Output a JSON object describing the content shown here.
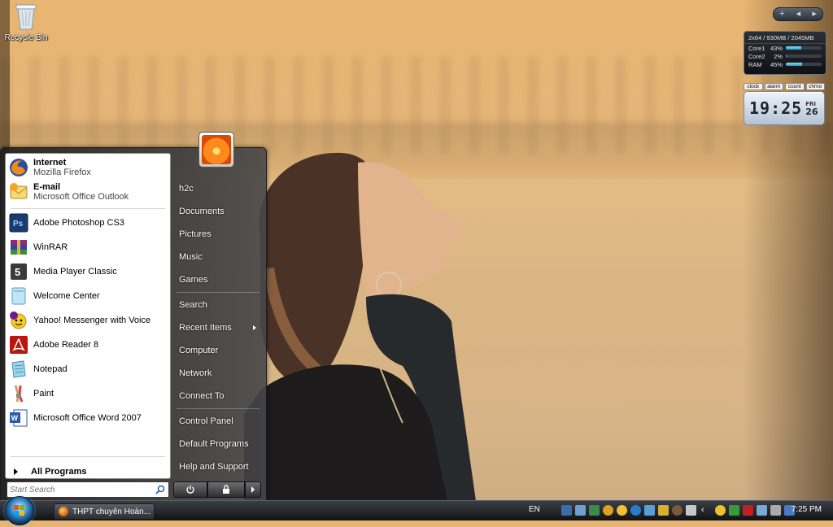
{
  "desktop": {
    "recycle_bin_label": "Recycle Bin"
  },
  "gadgets": {
    "cpu": {
      "header": "2x64 / 930MB / 2045MB",
      "rows": [
        {
          "name": "Core1",
          "percent": "43%",
          "level": 0.43
        },
        {
          "name": "Core2",
          "percent": "2%",
          "level": 0.02
        },
        {
          "name": "RAM",
          "percent": "45%",
          "level": 0.45
        }
      ]
    },
    "clock": {
      "tabs": [
        "clock",
        "alarm",
        "count",
        "chrno"
      ],
      "time": "19:25",
      "day_name": "FRI",
      "day_num": "26"
    },
    "sidebar_controls": {
      "add": "+",
      "prev": "◂",
      "next": "▸"
    }
  },
  "start_menu": {
    "pinned": [
      {
        "title": "Internet",
        "subtitle": "Mozilla Firefox",
        "icon": "firefox-icon"
      },
      {
        "title": "E-mail",
        "subtitle": "Microsoft Office Outlook",
        "icon": "outlook-icon"
      }
    ],
    "recent": [
      {
        "label": "Adobe Photoshop CS3",
        "icon": "photoshop-icon"
      },
      {
        "label": "WinRAR",
        "icon": "winrar-icon"
      },
      {
        "label": "Media Player Classic",
        "icon": "media-player-icon"
      },
      {
        "label": "Welcome Center",
        "icon": "welcome-center-icon"
      },
      {
        "label": "Yahoo! Messenger with Voice",
        "icon": "yahoo-messenger-icon"
      },
      {
        "label": "Adobe Reader 8",
        "icon": "adobe-reader-icon"
      },
      {
        "label": "Notepad",
        "icon": "notepad-icon"
      },
      {
        "label": "Paint",
        "icon": "paint-icon"
      },
      {
        "label": "Microsoft Office Word 2007",
        "icon": "word-icon"
      }
    ],
    "all_programs": "All Programs",
    "search_placeholder": "Start Search",
    "right_items": {
      "user": "h2c",
      "documents": "Documents",
      "pictures": "Pictures",
      "music": "Music",
      "games": "Games",
      "search": "Search",
      "recent_items": "Recent Items",
      "computer": "Computer",
      "network": "Network",
      "connect_to": "Connect To",
      "control_panel": "Control Panel",
      "default_programs": "Default Programs",
      "help_support": "Help and Support"
    }
  },
  "taskbar": {
    "window_title": "THPT chuyên Hoàn...",
    "language": "EN",
    "time": "7:25 PM"
  },
  "colors": {
    "accent_blue": "#2c78b8",
    "menu_dark": "#2a2a2c"
  }
}
